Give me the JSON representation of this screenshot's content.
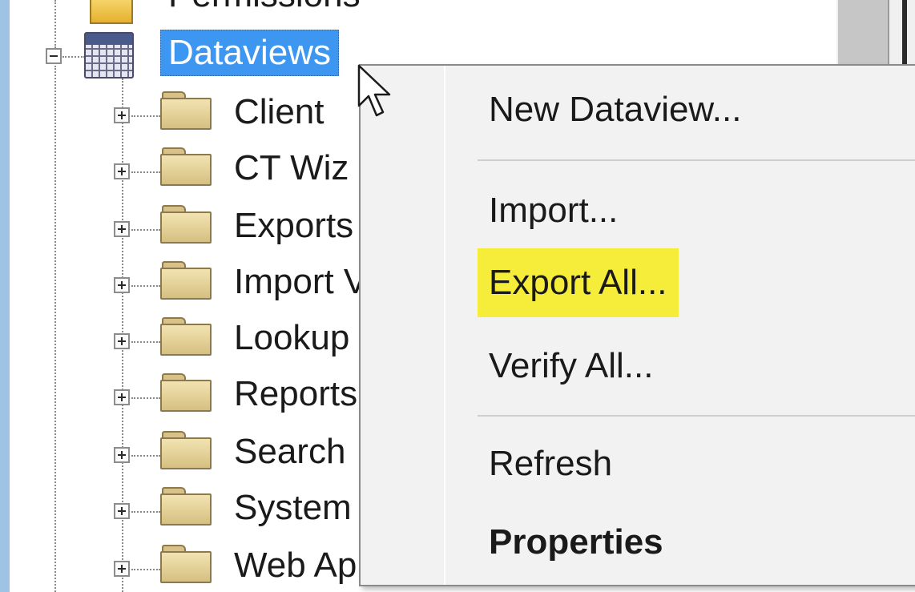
{
  "tree": {
    "root_partial_label": "Permissions",
    "dataviews_label": "Dataviews",
    "children": [
      {
        "label": "Client"
      },
      {
        "label": "CT Wiz"
      },
      {
        "label": "Exports"
      },
      {
        "label": "Import V"
      },
      {
        "label": "Lookup"
      },
      {
        "label": "Reports"
      },
      {
        "label": "Search"
      },
      {
        "label": "System"
      },
      {
        "label": "Web Ap"
      }
    ]
  },
  "context_menu": {
    "items": {
      "new_dataview": "New Dataview...",
      "import": "Import...",
      "export_all": "Export All...",
      "verify_all": "Verify All...",
      "refresh": "Refresh",
      "properties": "Properties"
    }
  },
  "colors": {
    "selection": "#3d97f0",
    "highlight": "#f6ec3a",
    "frame": "#9fc3e4"
  },
  "icons": {
    "expander_collapsed": "plus-icon",
    "expander_expanded": "minus-icon",
    "folder": "folder-icon",
    "dataviews": "dataview-grid-icon",
    "cursor": "mouse-pointer-icon"
  }
}
